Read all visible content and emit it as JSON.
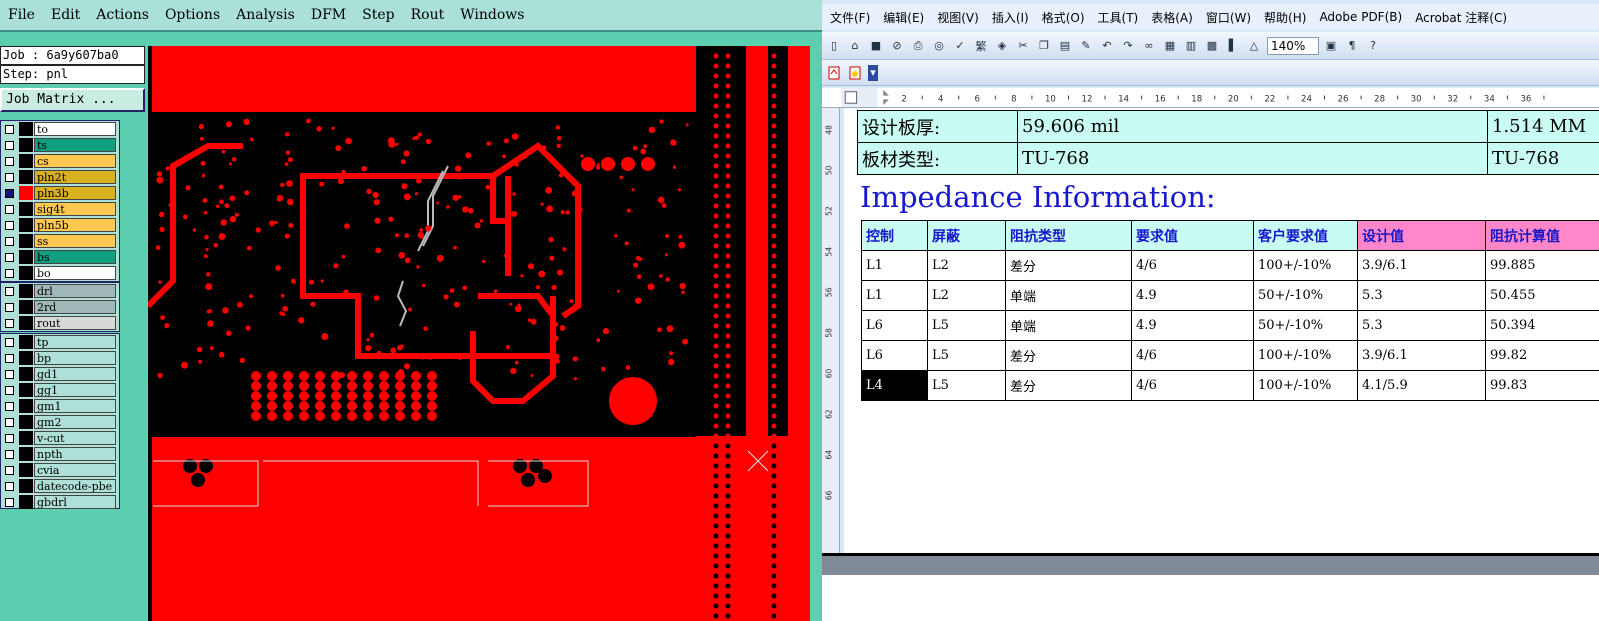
{
  "cam": {
    "menu": [
      "File",
      "Edit",
      "Actions",
      "Options",
      "Analysis",
      "DFM",
      "Step",
      "Rout",
      "Windows"
    ],
    "job_label": "Job : 6a9y607ba0",
    "step_label": "Step: pnl",
    "job_matrix": "Job Matrix ...",
    "layers_group1": [
      {
        "name": "to",
        "color": "#ffffff"
      },
      {
        "name": "ts",
        "color": "#10a080"
      },
      {
        "name": "cs",
        "color": "#ffc850"
      },
      {
        "name": "pln2t",
        "color": "#d8b020"
      },
      {
        "name": "pln3b",
        "color": "#d8b020",
        "active": true
      },
      {
        "name": "sig4t",
        "color": "#ffc850"
      },
      {
        "name": "pln5b",
        "color": "#ffc850"
      },
      {
        "name": "ss",
        "color": "#ffc850"
      },
      {
        "name": "bs",
        "color": "#10a080"
      },
      {
        "name": "bo",
        "color": "#ffffff"
      }
    ],
    "layers_group2": [
      {
        "name": "drl",
        "color": "#a0b8b8"
      },
      {
        "name": "2rd",
        "color": "#a0b8b8"
      },
      {
        "name": "rout",
        "color": "#d8d8d8"
      }
    ],
    "layers_group3": [
      {
        "name": "tp",
        "color": "#aee0d8"
      },
      {
        "name": "bp",
        "color": "#aee0d8"
      },
      {
        "name": "gd1",
        "color": "#aee0d8"
      },
      {
        "name": "gg1",
        "color": "#aee0d8"
      },
      {
        "name": "gm1",
        "color": "#aee0d8"
      },
      {
        "name": "gm2",
        "color": "#aee0d8"
      },
      {
        "name": "v-cut",
        "color": "#aee0d8"
      },
      {
        "name": "npth",
        "color": "#aee0d8"
      },
      {
        "name": "cvia",
        "color": "#aee0d8"
      },
      {
        "name": "datecode-pbe",
        "color": "#aee0d8"
      },
      {
        "name": "gbdrl",
        "color": "#aee0d8"
      }
    ]
  },
  "word": {
    "menu": [
      "文件(F)",
      "编辑(E)",
      "视图(V)",
      "插入(I)",
      "格式(O)",
      "工具(T)",
      "表格(A)",
      "窗口(W)",
      "帮助(H)",
      "Adobe PDF(B)",
      "Acrobat 注释(C)"
    ],
    "zoom": "140%",
    "ruler_marks": [
      "2",
      "4",
      "6",
      "8",
      "10",
      "12",
      "14",
      "16",
      "18",
      "20",
      "22",
      "24",
      "26",
      "28",
      "30",
      "32",
      "34",
      "36"
    ],
    "vruler_marks": [
      "48",
      "50",
      "52",
      "54",
      "56",
      "58",
      "60",
      "62",
      "64",
      "66"
    ],
    "info_rows": [
      [
        "设计板厚:",
        "59.606 mil",
        "1.514 MM"
      ],
      [
        "板材类型:",
        "TU-768",
        "TU-768"
      ]
    ],
    "impedance_title": "Impedance Information:",
    "imp_headers": [
      "控制",
      "屏蔽",
      "阻抗类型",
      "要求值",
      "客户要求值",
      "设计值",
      "阻抗计算值"
    ],
    "imp_rows": [
      [
        "L1",
        "L2",
        "差分",
        "4/6",
        "100+/-10%",
        "3.9/6.1",
        "99.885"
      ],
      [
        "L1",
        "L2",
        "单端",
        "4.9",
        "50+/-10%",
        "5.3",
        "50.455"
      ],
      [
        "L6",
        "L5",
        "单端",
        "4.9",
        "50+/-10%",
        "5.3",
        "50.394"
      ],
      [
        "L6",
        "L5",
        "差分",
        "4/6",
        "100+/-10%",
        "3.9/6.1",
        "99.82"
      ],
      [
        "L4",
        "L5",
        "差分",
        "4/6",
        "100+/-10%",
        "4.1/5.9",
        "99.83"
      ]
    ]
  },
  "colors": {
    "pcb_red": "#ff0000",
    "pcb_black": "#000000",
    "cam_bg": "#5ccfb0",
    "header_cyan": "#c8fcf3",
    "header_pink": "#ff86c8"
  }
}
